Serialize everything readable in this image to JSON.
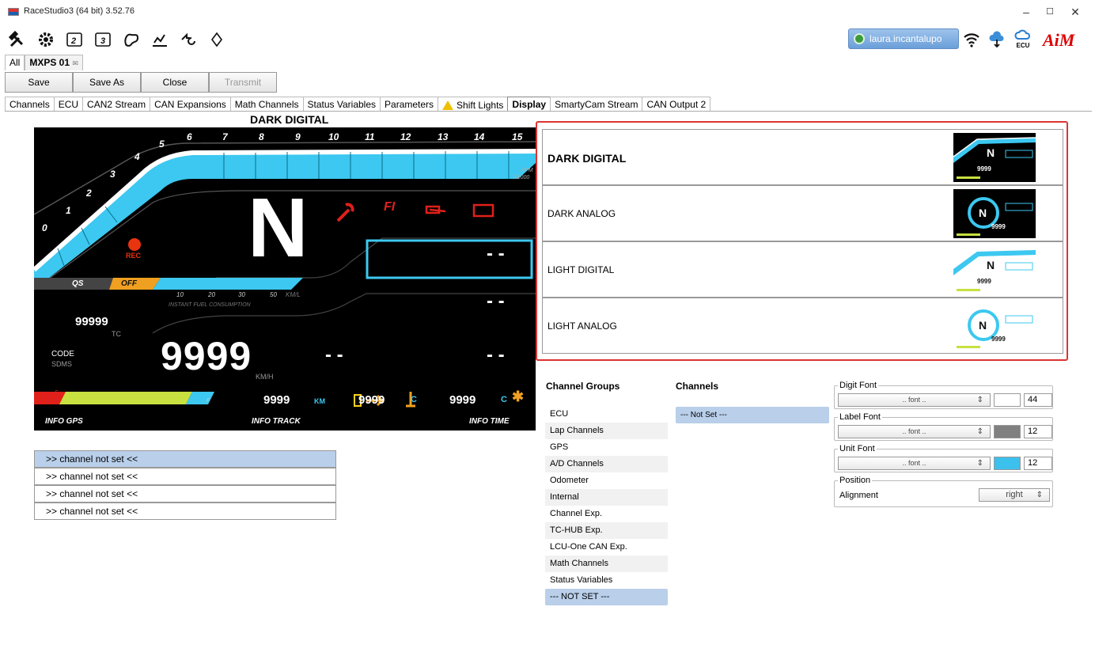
{
  "window": {
    "title": "RaceStudio3 (64 bit) 3.52.76",
    "minimize": "–",
    "maximize": "☐",
    "close": "✕"
  },
  "toolbar": {
    "tools": [
      "wrench-icon",
      "gear-icon",
      "device-2-icon",
      "device-3-icon",
      "track-icon",
      "chart-icon",
      "transfer-icon",
      "navigator-icon"
    ],
    "user": "laura.incantalupo",
    "right_icons": [
      "wifi-icon",
      "cloud-download-icon",
      "ecu-cloud-icon",
      "aim-logo"
    ],
    "ecu_label": "ECU",
    "logo": "AiM"
  },
  "file_tabs": {
    "all": "All",
    "config": "MXPS 01",
    "close_glyph": "✉"
  },
  "actions": {
    "save": "Save",
    "save_as": "Save As",
    "close": "Close",
    "transmit": "Transmit"
  },
  "config_tabs": [
    "Channels",
    "ECU",
    "CAN2 Stream",
    "CAN Expansions",
    "Math Channels",
    "Status Variables",
    "Parameters",
    "Shift Lights",
    "Display",
    "SmartyCam Stream",
    "CAN Output 2"
  ],
  "active_tab": "Display",
  "preview": {
    "title": "DARK DIGITAL",
    "rpm_ticks": [
      "0",
      "1",
      "2",
      "3",
      "4",
      "5",
      "6",
      "7",
      "8",
      "9",
      "10",
      "11",
      "12",
      "13",
      "14",
      "15"
    ],
    "rpm_unit": "RPM",
    "rpm_mult": "X1000",
    "gear": "N",
    "rec": "REC",
    "qs": "QS",
    "qs_state": "OFF",
    "fuel_ticks": [
      "10",
      "20",
      "30",
      "50",
      "KM/L"
    ],
    "fuel_label": "INSTANT FUEL CONSUMPTION",
    "tc_value": "99999",
    "tc_label": "TC",
    "code": "CODE",
    "code_sub": "SDMS",
    "speed": "9999",
    "speed_unit": "KM/H",
    "dash_placeholder": "- -",
    "fuel_e": "E",
    "fuel_f": "F",
    "odo": "9999",
    "odo_unit": "KM",
    "temp1": "9999",
    "temp1_unit": "C",
    "temp2": "9999",
    "temp2_unit": "C",
    "info_gps": "INFO GPS",
    "info_track": "INFO TRACK",
    "info_time": "INFO TIME",
    "fi": "FI",
    "accent": "#3cc8f0"
  },
  "slots": [
    ">>  channel not set  <<",
    ">>  channel not set  <<",
    ">>  channel not set  <<",
    ">>  channel not set  <<"
  ],
  "themes": [
    "DARK DIGITAL",
    "DARK ANALOG",
    "LIGHT DIGITAL",
    "LIGHT ANALOG"
  ],
  "channel_groups": {
    "header": "Channel Groups",
    "items": [
      "ECU",
      "Lap Channels",
      "GPS",
      "A/D Channels",
      "Odometer",
      "Internal",
      "Channel Exp.",
      "TC-HUB Exp.",
      "LCU-One CAN Exp.",
      "Math Channels",
      "Status Variables",
      "--- NOT SET ---"
    ]
  },
  "channels": {
    "header": "Channels",
    "items": [
      "--- Not Set ---"
    ]
  },
  "fonts": {
    "digit": {
      "label": "Digit Font",
      "select": ".. font ..",
      "size": "44",
      "color": "#ffffff"
    },
    "label": {
      "label": "Label Font",
      "select": ".. font ..",
      "size": "12",
      "color": "#808080"
    },
    "unit": {
      "label": "Unit Font",
      "select": ".. font ..",
      "size": "12",
      "color": "#3cc0ec"
    }
  },
  "position": {
    "label": "Position",
    "alignment_label": "Alignment",
    "alignment": "right"
  },
  "select_arrow": "⇕"
}
